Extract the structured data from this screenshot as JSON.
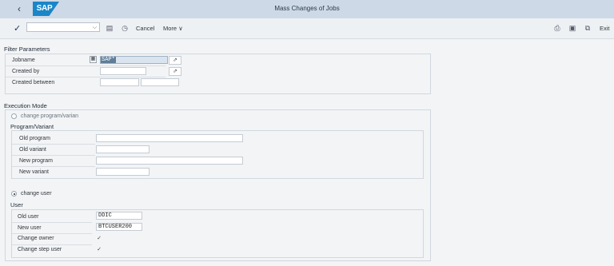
{
  "header": {
    "title": "Mass Changes of Jobs",
    "logo": "SAP",
    "back_icon": "chevron-left-icon"
  },
  "toolbar": {
    "cancel_label": "Cancel",
    "more_label": "More",
    "exit_label": "Exit",
    "more_arrow": "∨"
  },
  "filter": {
    "title": "Filter Parameters",
    "jobname_label": "Jobname",
    "jobname_value": "SAP*",
    "created_by_label": "Created by",
    "created_between_label": "Created between"
  },
  "execution": {
    "title": "Execution Mode",
    "change_program_label": "change program/varian",
    "program_section": "Program/Variant",
    "old_program_label": "Old program",
    "old_variant_label": "Old variant",
    "new_program_label": "New program",
    "new_variant_label": "New variant",
    "change_user_label": "change user",
    "user_section": "User",
    "old_user_label": "Old user",
    "old_user_value": "DDIC",
    "new_user_label": "New user",
    "new_user_value": "BTCUSER200",
    "change_owner_label": "Change owner",
    "change_step_user_label": "Change step user"
  }
}
